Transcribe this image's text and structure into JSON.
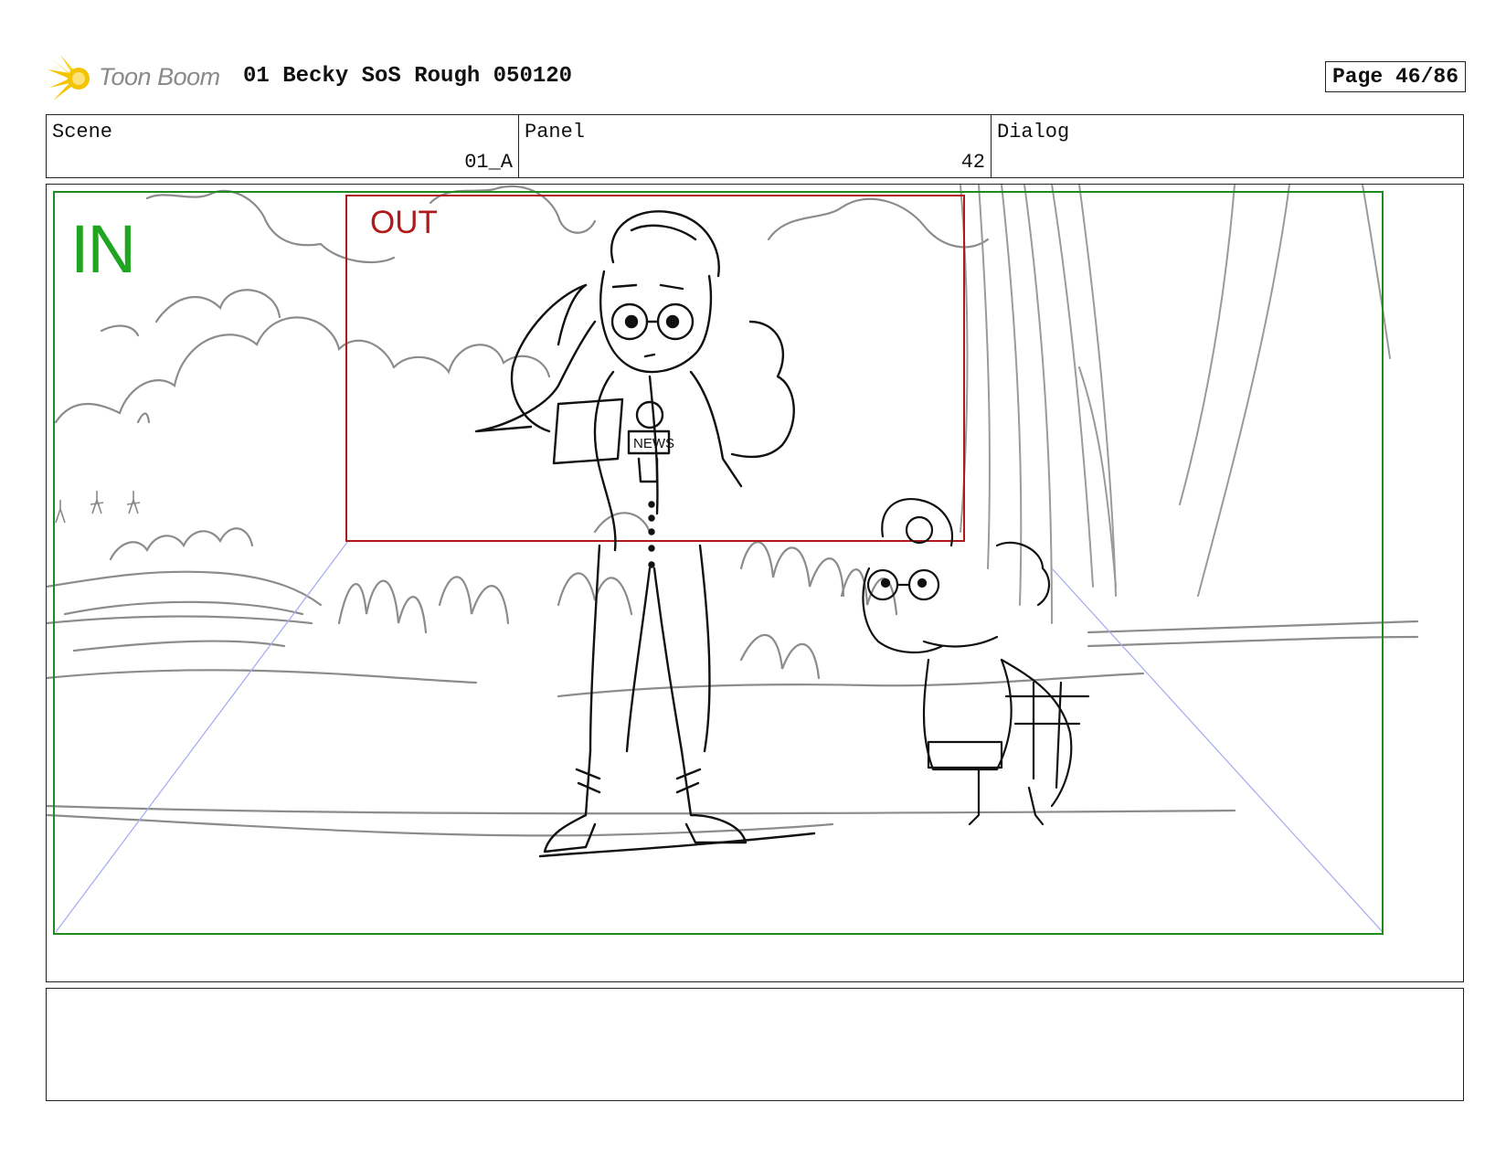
{
  "header": {
    "brand": "Toon Boom",
    "title": "01 Becky SoS Rough 050120",
    "page": "Page 46/86"
  },
  "info": {
    "scene_label": "Scene",
    "scene_value": "01_A",
    "panel_label": "Panel",
    "panel_value": "42",
    "dialog_label": "Dialog",
    "dialog_value": ""
  },
  "frame": {
    "in_label": "IN",
    "out_label": "OUT",
    "mic_text": "NEWS"
  },
  "colors": {
    "in_frame": "#1f8a1f",
    "out_frame": "#b01a1a",
    "perspective": "#a9aef0",
    "logo": "#f5c400"
  },
  "notes": {
    "text": ""
  }
}
